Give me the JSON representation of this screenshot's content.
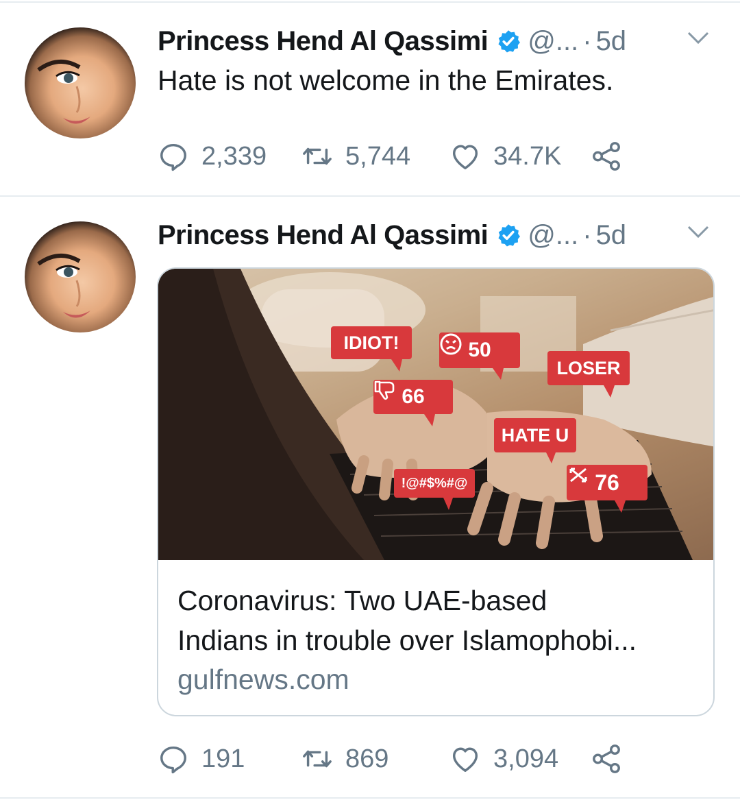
{
  "tweets": [
    {
      "author_name": "Princess Hend Al Qassimi",
      "handle": "@...",
      "separator": "·",
      "time": "5d",
      "text": "Hate is not welcome in the Emirates.",
      "replies": "2,339",
      "retweets": "5,744",
      "likes": "34.7K"
    },
    {
      "author_name": "Princess Hend Al Qassimi",
      "handle": "@...",
      "separator": "·",
      "time": "5d",
      "card": {
        "title_line1": "Coronavirus: Two UAE-based",
        "title_line2": "Indians in trouble over Islamophobi...",
        "domain": "gulfnews.com",
        "image_labels": {
          "idiot": "IDIOT!",
          "angry_count": "50",
          "loser": "LOSER",
          "dislike_count": "66",
          "hate_u": "HATE U",
          "symbols": "!@#$%#@",
          "cross_count": "76"
        }
      },
      "replies": "191",
      "retweets": "869",
      "likes": "3,094"
    }
  ],
  "icons": {
    "reply": "reply-icon",
    "retweet": "retweet-icon",
    "like": "heart-icon",
    "share": "share-icon",
    "verified": "verified-badge-icon",
    "menu": "chevron-down-icon"
  },
  "colors": {
    "verified_blue": "#1da1f2",
    "secondary_text": "#657786",
    "bubble_red": "#d8393c"
  }
}
